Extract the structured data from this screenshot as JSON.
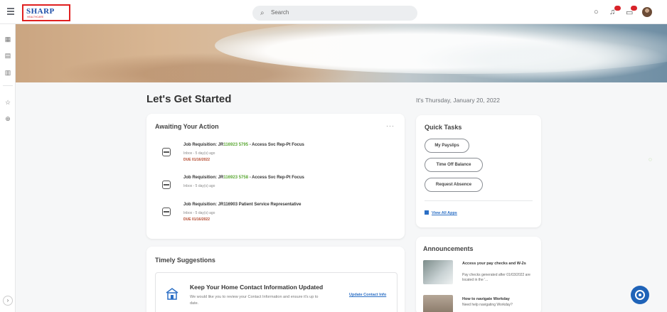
{
  "header": {
    "logo_text": "SHARP",
    "logo_sub": "HEALTHCARE",
    "search_placeholder": "Search",
    "notifications_badge": "",
    "inbox_badge": "",
    "icons": [
      "menu-icon",
      "search-icon",
      "chat-bubble-icon",
      "bell-icon",
      "inbox-icon",
      "avatar"
    ]
  },
  "sidebar": {
    "icons": [
      "dashboard-icon",
      "apps-icon",
      "chart-icon",
      "star-icon",
      "globe-icon"
    ],
    "expand_icon": "chevron-right-icon"
  },
  "main": {
    "title": "Let's Get Started",
    "date": "It's Thursday, January 20, 2022",
    "awaiting": {
      "title": "Awaiting Your Action",
      "more": "···",
      "tasks": [
        {
          "title_prefix": "Job Requisition: JR",
          "title_highlight": "116923 5795",
          "title_suffix": " - Access Svc Rep-Pt Focus",
          "meta": "Inbox - 5 day(s) ago",
          "due": "DUE 01/16/2022"
        },
        {
          "title_prefix": "Job Requisition: JR",
          "title_highlight": "116923 5758",
          "title_suffix": " - Access Svc Rep-Pt Focus",
          "meta": "Inbox - 5 day(s) ago",
          "due": ""
        },
        {
          "title_prefix": "Job Requisition: JR116903 Patient Service Representative",
          "title_highlight": "",
          "title_suffix": "",
          "meta": "Inbox - 5 day(s) ago",
          "due": "DUE 01/16/2022"
        }
      ]
    },
    "quick_tasks": {
      "title": "Quick Tasks",
      "buttons": [
        "My Payslips",
        "Time Off Balance",
        "Request Absence"
      ],
      "view_all": "View All Apps"
    },
    "announcements": {
      "title": "Announcements",
      "items": [
        {
          "title": "Access your pay checks and W-2s",
          "text": "Pay checks generated after 01/03/2022 are located in the '..."
        },
        {
          "title": "How to navigate Workday",
          "text": "Need help navigating Workday?"
        }
      ]
    },
    "timely": {
      "title": "Timely Suggestions",
      "suggestion_title": "Keep Your Home Contact Information Updated",
      "suggestion_text": "We would like you to review your Contact Information and ensure it's up to date.",
      "suggestion_link": "Update Contact Info"
    }
  },
  "colors": {
    "accent": "#2b6fc5",
    "highlight_green": "#5aa733",
    "due_red": "#b4472b",
    "logo_red": "#e02020",
    "help_blue": "#1f63b8"
  }
}
